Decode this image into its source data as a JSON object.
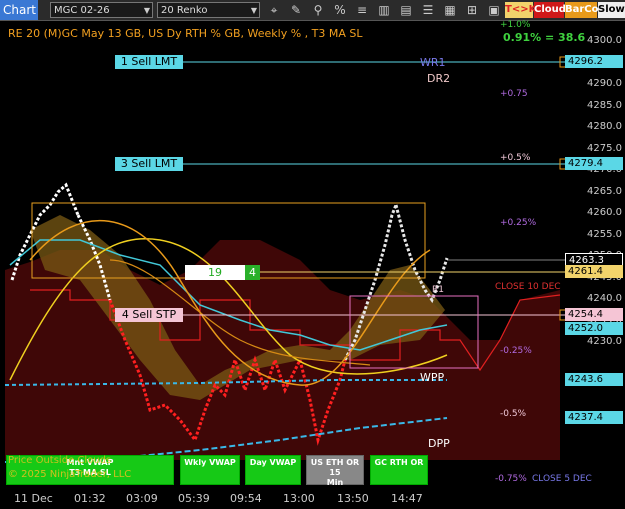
{
  "toolbar": {
    "title": "Chart",
    "instrument": "MGC 02-26",
    "bar_type": "20 Renko",
    "buttons": {
      "tk": "T<>K",
      "cloud": "Cloud",
      "barcol": "BarCol",
      "slow": "SlowM"
    },
    "icons": [
      "crosshair-icon",
      "pencil-icon",
      "zoom-icon",
      "percent-icon",
      "list-icon",
      "bars-icon",
      "template-icon",
      "properties-icon"
    ]
  },
  "chart": {
    "title": "RE 20  (M)GC May 13 GB, US Dy RTH % GB, Weekly % , T3 MA SL",
    "top_right_label": "0.91% = 38.6",
    "labels": {
      "pct_top": "+1.0%",
      "pct_075": "+0.75",
      "pct_05": "+0.5%",
      "pct_025": "+0.25%",
      "pct_m025": "-0.25%",
      "pct_m05": "-0.5%",
      "pct_m075": "-0.75%",
      "wr1": "WR1",
      "dr2": "DR2",
      "wpp": "WPP",
      "dpp": "DPP",
      "close10": "CLOSE 10 DEC",
      "close5": "CLOSE 5 DEC",
      "r1": "R1",
      "sell1": "1 Sell LMT",
      "sell3": "3 Sell LMT",
      "sell4": "4 Sell STP",
      "ord_qty": "19",
      "ord_n": "4"
    },
    "watermark": {
      "line1": "Price Outside Clouds",
      "line2": "© 2025 NinjaTrader, LLC"
    },
    "bottom_buttons": [
      "Mnt VWAP\nT3 MA SL",
      "Wkly VWAP",
      "Day VWAP",
      "US ETH OR 15\nMin",
      "GC RTH OR"
    ],
    "y_axis": [
      "4300.0",
      "4295.0",
      "4290.0",
      "4285.0",
      "4280.0",
      "4275.0",
      "4270.0",
      "4265.0",
      "4260.0",
      "4255.0",
      "4250.0",
      "4245.0",
      "4240.0",
      "4235.0",
      "4230.0"
    ],
    "x_axis": [
      "11 Dec",
      "01:32",
      "03:09",
      "05:39",
      "09:54",
      "13:00",
      "13:50",
      "14:47"
    ],
    "price_tags": [
      {
        "value": "4296.2",
        "bg": "#5bd7e6",
        "fg": "#000"
      },
      {
        "value": "4279.4",
        "bg": "#5bd7e6",
        "fg": "#000"
      },
      {
        "value": "4263.3",
        "bg": "#000",
        "fg": "#fff"
      },
      {
        "value": "4261.4",
        "bg": "#f2d36b",
        "fg": "#000"
      },
      {
        "value": "4254.4",
        "bg": "#f5c5d5",
        "fg": "#000"
      },
      {
        "value": "4252.0",
        "bg": "#5bd7e6",
        "fg": "#000"
      },
      {
        "value": "4243.6",
        "bg": "#5bd7e6",
        "fg": "#000"
      },
      {
        "value": "4237.4",
        "bg": "#5bd7e6",
        "fg": "#000"
      }
    ]
  }
}
